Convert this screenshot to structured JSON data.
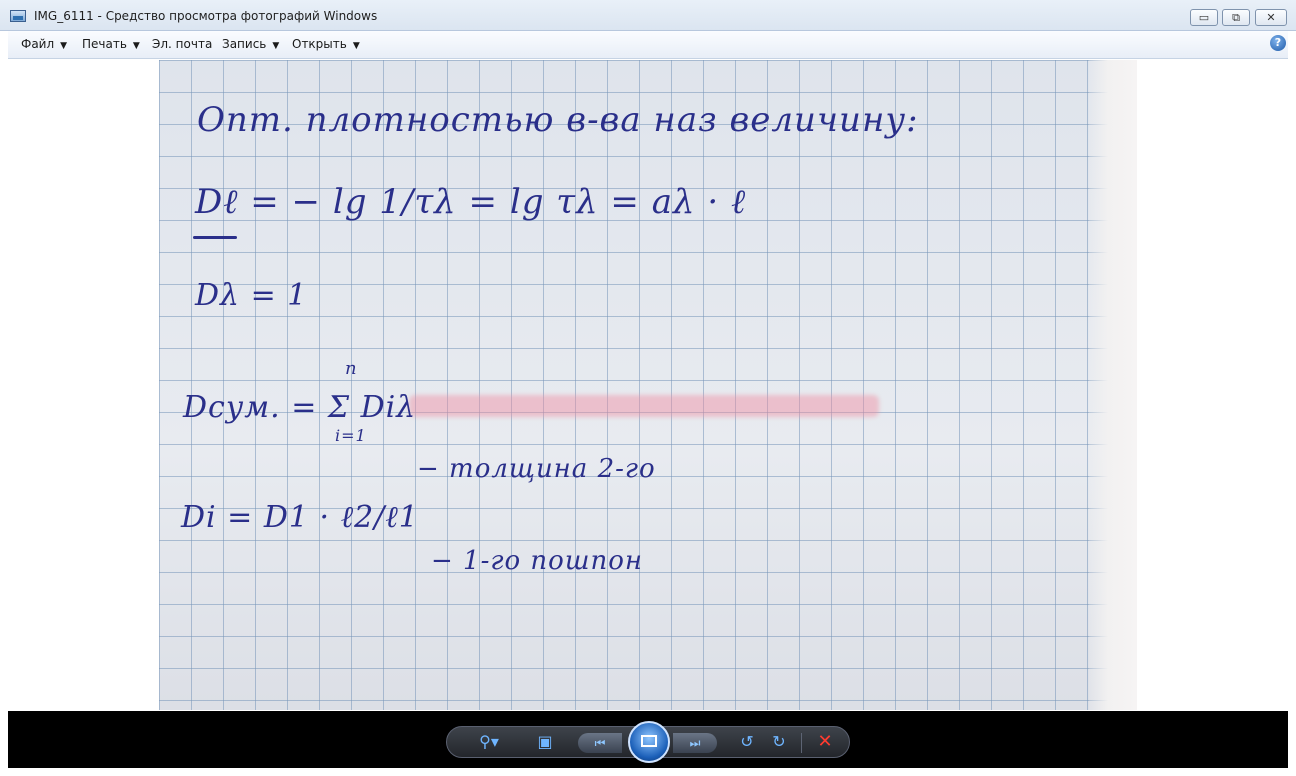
{
  "window": {
    "title": "IMG_6111 - Средство просмотра фотографий Windows",
    "min_label": "▭",
    "max_label": "⧉",
    "close_label": "✕"
  },
  "menu": {
    "file": "Файл",
    "print": "Печать",
    "email": "Эл. почта",
    "burn": "Запись",
    "open": "Открыть",
    "caret": "▼",
    "help": "?"
  },
  "photo": {
    "line1": "Опт. плотностью в-ва наз величину:",
    "line2": "Dℓ = − lg 1/τλ = lg τλ = aλ · ℓ",
    "line3": "Dλ = 1",
    "line4": "Dсум. = Σ Diλ",
    "line4_sub": "i=1",
    "line4_sup": "n",
    "line5": "Di = D1 · ℓ2/ℓ1",
    "line6": "− толщина 2-го",
    "line7": "− 1-го пошпон"
  },
  "toolbar": {
    "zoom_icon": "zoom-icon",
    "zoom": "⚲▾",
    "actual": "▣",
    "prev": "⏮",
    "next": "⏭",
    "rotate_ccw": "↺",
    "rotate_cw": "↻",
    "delete": "✕"
  }
}
